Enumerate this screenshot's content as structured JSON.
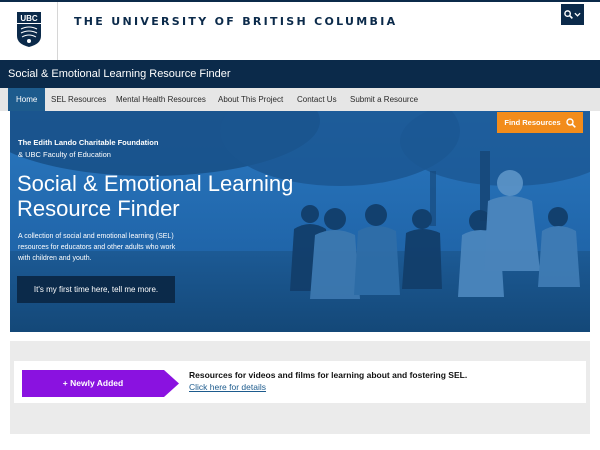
{
  "header": {
    "logo_text": "UBC",
    "wordmark": "THE UNIVERSITY OF BRITISH COLUMBIA",
    "search_icon": "search-icon",
    "chevron_icon": "chevron-down-icon"
  },
  "site": {
    "title": "Social & Emotional Learning Resource Finder"
  },
  "nav": {
    "items": [
      {
        "label": "Home",
        "active": true
      },
      {
        "label": "SEL Resources"
      },
      {
        "label": "Mental Health Resources"
      },
      {
        "label": "About This Project"
      },
      {
        "label": "Contact Us"
      },
      {
        "label": "Submit a Resource"
      }
    ]
  },
  "hero": {
    "org_line1": "The Edith Lando Charitable Foundation",
    "org_line2": "& UBC Faculty of Education",
    "title": "Social & Emotional Learning Resource Finder",
    "description": "A collection of social and emotional learning (SEL) resources for educators and other adults who work with children and youth.",
    "cta_label": "It's my first time here, tell me more.",
    "find_label": "Find Resources"
  },
  "newly_added": {
    "badge_label": "+ Newly Added",
    "headline": "Resources for videos and films for learning about and fostering SEL.",
    "link_label": "Click here for details"
  },
  "colors": {
    "navy": "#0b2a4a",
    "nav_active": "#1d5b8d",
    "hero_blue": "#1c5fa3",
    "find_orange": "#f28c1b",
    "badge_purple": "#8a12e0"
  }
}
